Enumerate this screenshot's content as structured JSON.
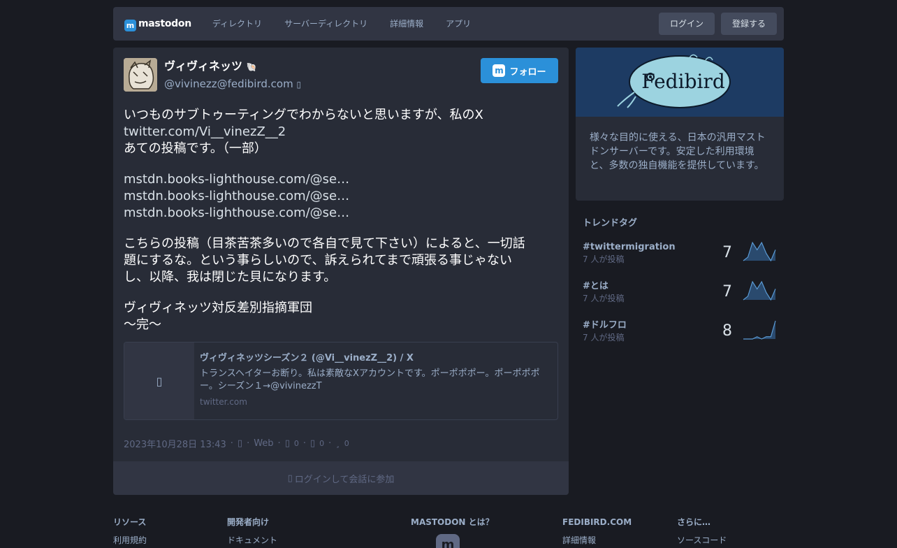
{
  "header": {
    "logo_text": "mastodon",
    "nav": [
      "ディレクトリ",
      "サーバーディレクトリ",
      "詳細情報",
      "アプリ"
    ],
    "login": "ログイン",
    "register": "登録する"
  },
  "post": {
    "display_name": "ヴィヴィネッツ",
    "acct": "@vivinezz@fedibird.com",
    "follow": "フォロー",
    "content": {
      "p1": [
        "いつものサブトゥーティングでわからないと思いますが、私のX",
        "twitter.com/Vi__vinezZ__2",
        "あての投稿です。（一部）"
      ],
      "p2": [
        "mstdn.books-lighthouse.com/@se…",
        "mstdn.books-lighthouse.com/@se…",
        "mstdn.books-lighthouse.com/@se…"
      ],
      "p3": [
        "こちらの投稿（目茶苦茶多いので各自で見て下さい）によると、一切話",
        "題にするな。という事らしいので、訴えられてまで頑張る事じゃない",
        "し、以降、我は閉じた貝になります。"
      ],
      "p4": [
        "ヴィヴィネッツ対反差別指摘軍団",
        "〜完〜"
      ]
    },
    "card": {
      "title": "ヴィヴィネッツシーズン２ (@Vi__vinezZ__2) / X",
      "description": "トランスヘイターお断り。私は素敵なXアカウントです。ポーポポポー。ポーポポポー。シーズン１→@vivinezzT",
      "host": "twitter.com"
    },
    "meta": {
      "date": "2023年10月28日 13:43",
      "app": "Web",
      "reblogs": "0",
      "favourites": "0",
      "bookmarks": "0"
    },
    "join": "ログインして会話に参加"
  },
  "server": {
    "banner_text": "Fedibird",
    "description": "様々な目的に使える、日本の汎用マストドンサーバーです。安定した利用環境と、多数の独自機能を提供しています。"
  },
  "trends": {
    "title": "トレンドタグ",
    "items": [
      {
        "name": "#twittermigration",
        "sub": "7 人が投稿",
        "count": "7",
        "spark": [
          0,
          1,
          5,
          3,
          5,
          2,
          0,
          3
        ]
      },
      {
        "name": "#とは",
        "sub": "7 人が投稿",
        "count": "7",
        "spark": [
          0,
          1,
          5,
          3,
          5,
          2,
          0,
          3
        ]
      },
      {
        "name": "#ドルフロ",
        "sub": "7 人が投稿",
        "count": "8",
        "spark": [
          0,
          0,
          0,
          1,
          0,
          1,
          1,
          8
        ]
      }
    ]
  },
  "footer": {
    "resources": {
      "head": "リソース",
      "link": "利用規約"
    },
    "dev": {
      "head": "開発者向け",
      "link": "ドキュメント"
    },
    "about": {
      "head": "MASTODON とは？"
    },
    "server": {
      "head": "FEDIBIRD.COM",
      "link": "詳細情報"
    },
    "more": {
      "head": "さらに…",
      "link": "ソースコード"
    }
  },
  "colors": {
    "accent": "#2b90d9",
    "bg": "#191b22",
    "panel": "#282c37"
  }
}
